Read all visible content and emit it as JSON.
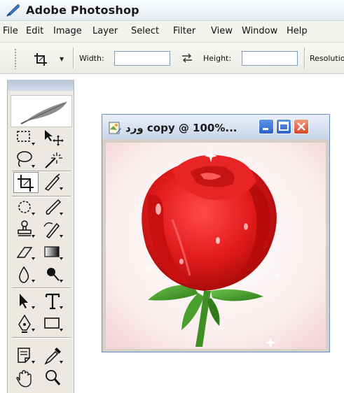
{
  "app": {
    "title": "Adobe Photoshop"
  },
  "menubar": {
    "items": [
      "File",
      "Edit",
      "Image",
      "Layer",
      "Select",
      "Filter",
      "View",
      "Window",
      "Help"
    ]
  },
  "options": {
    "width_label": "Width:",
    "width_value": "",
    "height_label": "Height:",
    "height_value": "",
    "resolution_label": "Resolution"
  },
  "document": {
    "title": "ورد copy @ 100%..."
  },
  "colors": {
    "accent_blue": "#2f62c9",
    "close_red": "#d9442a",
    "rose_red": "#d81a1a",
    "leaf_green": "#3f8f25"
  },
  "toolbox": {
    "tools": [
      "marquee-tool-icon",
      "move-tool-icon",
      "lasso-tool-icon",
      "magic-wand-tool-icon",
      "crop-tool-icon",
      "slice-tool-icon",
      "healing-brush-tool-icon",
      "brush-tool-icon",
      "clone-stamp-tool-icon",
      "history-brush-tool-icon",
      "eraser-tool-icon",
      "gradient-tool-icon",
      "blur-tool-icon",
      "dodge-tool-icon",
      "path-selection-tool-icon",
      "type-tool-icon",
      "pen-tool-icon",
      "shape-tool-icon",
      "notes-tool-icon",
      "eyedropper-tool-icon",
      "hand-tool-icon",
      "zoom-tool-icon"
    ]
  }
}
